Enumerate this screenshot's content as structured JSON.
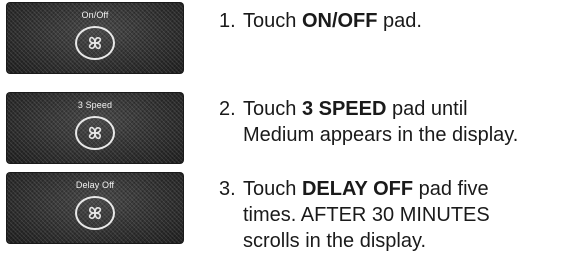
{
  "steps": [
    {
      "pad_label": "On/Off",
      "number": "1.",
      "pre": "Touch ",
      "bold": "ON/OFF",
      "post": " pad.",
      "extra_lines": []
    },
    {
      "pad_label": "3 Speed",
      "number": "2.",
      "pre": "Touch ",
      "bold": "3 SPEED",
      "post": " pad until",
      "extra_lines": [
        "Medium appears in the display."
      ]
    },
    {
      "pad_label": "Delay Off",
      "number": "3.",
      "pre": "Touch ",
      "bold": "DELAY OFF",
      "post": " pad five",
      "extra_lines": [
        "times. AFTER 30 MINUTES",
        "scrolls in the display."
      ]
    }
  ],
  "icons": {
    "pad_icon": "fan-icon"
  },
  "colors": {
    "pad_background": "#2a2a2a",
    "pad_foreground": "#e8e8e8",
    "text": "#1a1a1a"
  }
}
